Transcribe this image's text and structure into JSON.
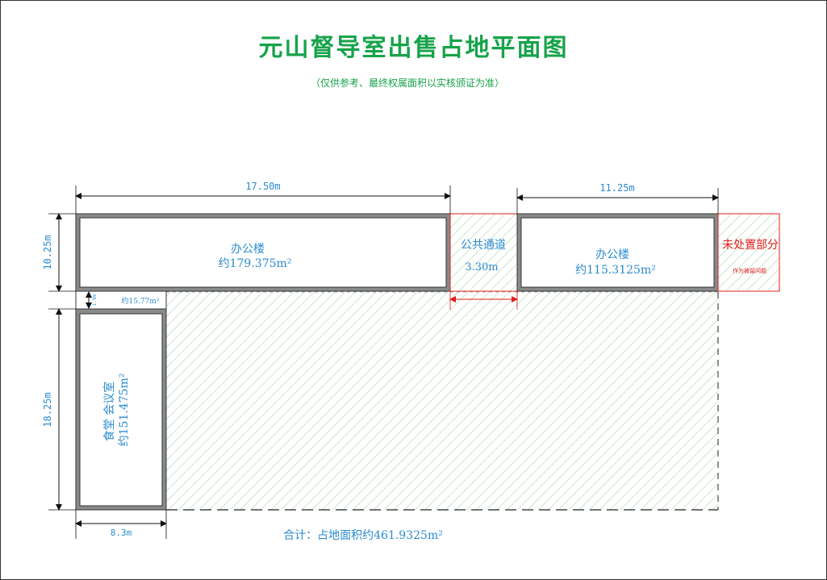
{
  "title": "元山督导室出售占地平面图",
  "subtitle": "（仅供参考、最终权属面积以实核颁证为准）",
  "dimensions": {
    "top_left_width": "17.50m",
    "top_right_width": "11.25m",
    "left_top_height": "10.25m",
    "left_bottom_height": "18.25m",
    "bottom_width": "8.3m",
    "small_height": "1.9m",
    "passage_width": "3.30m"
  },
  "rooms": {
    "office_left": {
      "name": "办公楼",
      "area": "约179.375m²"
    },
    "passage": {
      "name": "公共通道",
      "width": "3.30m"
    },
    "office_right": {
      "name": "办公楼",
      "area": "约115.3125m²"
    },
    "unsold": {
      "name": "未处置部分",
      "note": "作为被留问题"
    },
    "small": {
      "area": "约15.77m²"
    },
    "canteen": {
      "name": "食堂  会议室",
      "area": "约151.475m²"
    }
  },
  "total": "合计：占地面积约461.9325m²",
  "colors": {
    "title": "#16a34a",
    "label": "#2b8bd0",
    "red": "#e11d1d",
    "hatch": "#9ed39e",
    "wall": "#7a7a7a"
  }
}
